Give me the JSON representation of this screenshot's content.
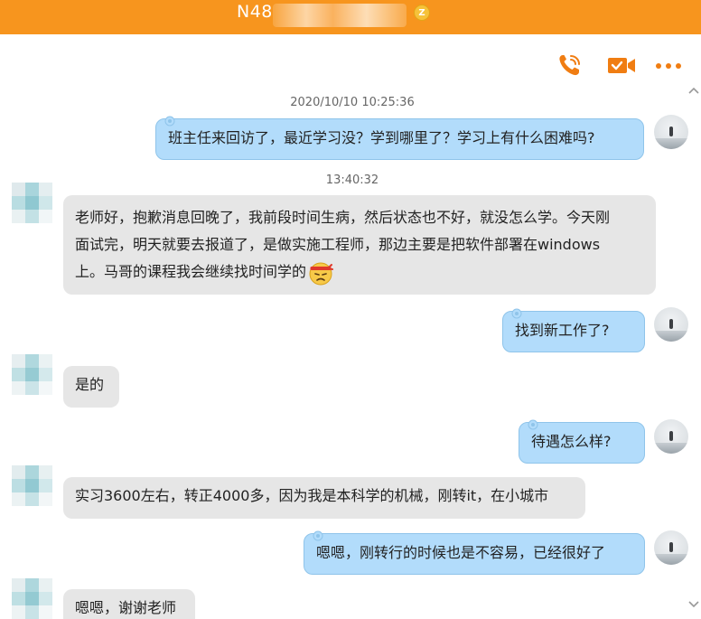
{
  "window": {
    "title": "N48",
    "badge": "Z"
  },
  "toolbar": {
    "icons": [
      "phone-icon",
      "video-call-icon",
      "more-options-icon"
    ],
    "accent": "#f07d12"
  },
  "colors": {
    "titlebar": "#f7951e",
    "outgoing_bubble": "#b2dcfb",
    "incoming_bubble": "#e6e6e6"
  },
  "chat": {
    "timestamp_1": "2020/10/10 10:25:36",
    "timestamp_2": "13:40:32",
    "messages": [
      {
        "sender": "self",
        "text": "班主任来回访了，最近学习没？学到哪里了？学习上有什么困难吗?"
      },
      {
        "sender": "contact",
        "lines": [
          "老师好，抱歉消息回晚了，我前段时间生病，然后状态也不好，就没怎么学。今天刚",
          "面试完，明天就要去报道了，是做实施工程师，那边主要是把软件部署在windows",
          "上。马哥的课程我会继续找时间学的"
        ],
        "emoji": "determined-face-emoji"
      },
      {
        "sender": "self",
        "text": "找到新工作了?"
      },
      {
        "sender": "contact",
        "text": "是的"
      },
      {
        "sender": "self",
        "text": "待遇怎么样?"
      },
      {
        "sender": "contact",
        "text": "实习3600左右，转正4000多，因为我是本科学的机械，刚转it，在小城市"
      },
      {
        "sender": "self",
        "text": "嗯嗯，刚转行的时候也是不容易，已经很好了"
      },
      {
        "sender": "contact",
        "text": "嗯嗯，谢谢老师"
      }
    ]
  }
}
